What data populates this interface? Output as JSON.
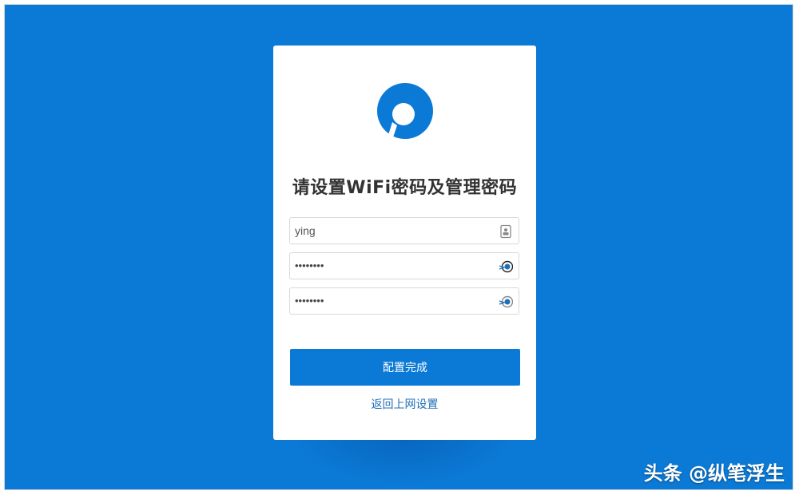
{
  "form": {
    "title": "请设置WiFi密码及管理密码",
    "username_value": "ying",
    "wifi_password_masked": "••••••••",
    "admin_password_masked": "••••••••",
    "submit_label": "配置完成",
    "back_link": "返回上网设置"
  },
  "watermark": "头条 @纵笔浮生",
  "icons": {
    "logo": "router-logo-icon",
    "user_field": "contact-card-icon",
    "password_toggle": "eye-toggle-icon"
  },
  "colors": {
    "brand_blue": "#0b7ad6",
    "card_bg": "#ffffff",
    "link": "#1f6fb5",
    "title_text": "#333333"
  }
}
